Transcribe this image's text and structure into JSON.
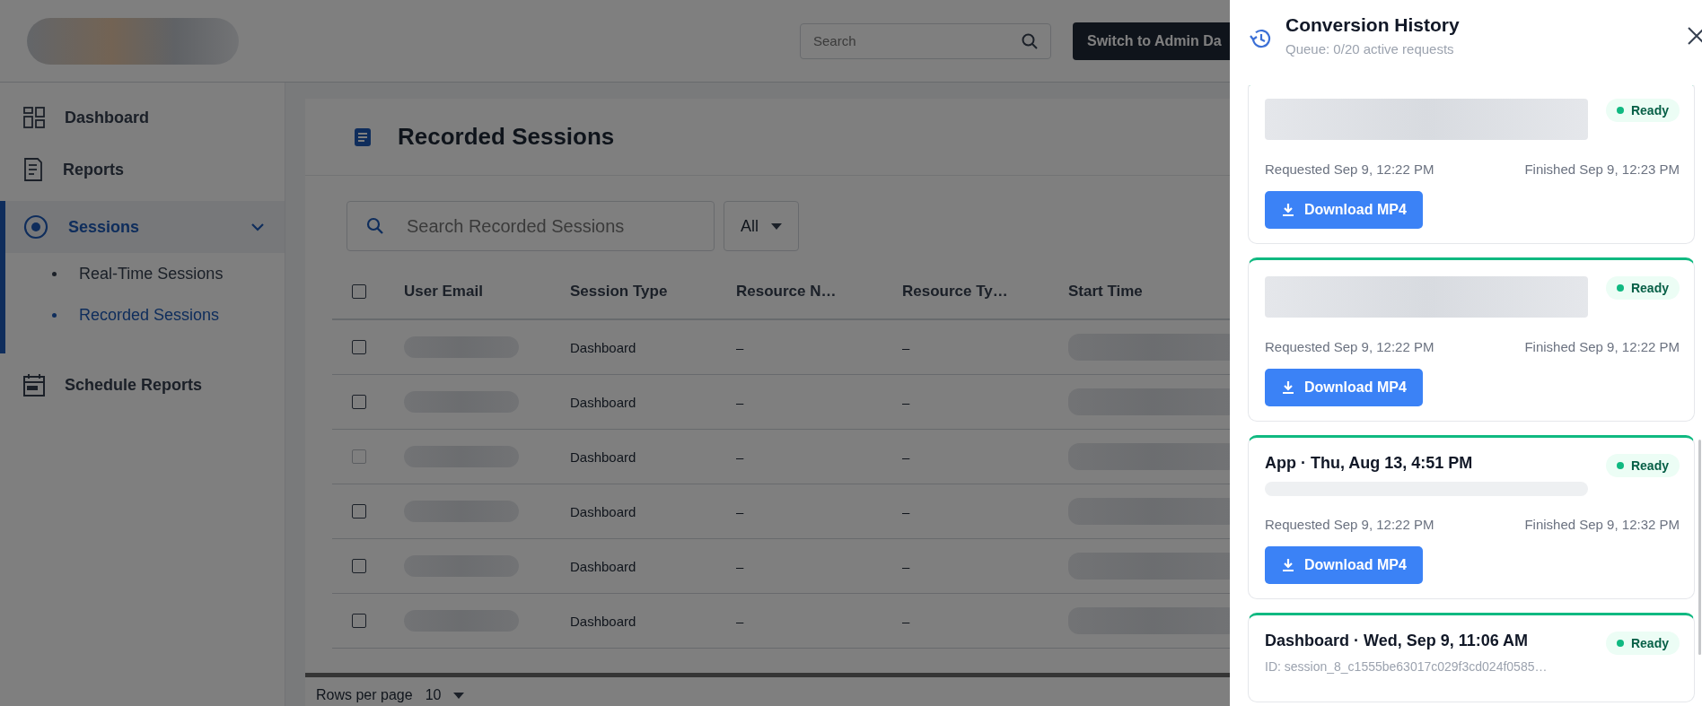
{
  "header": {
    "search": {
      "placeholder": "Search"
    },
    "admin_button": "Switch to Admin Da"
  },
  "sidebar": {
    "items": [
      {
        "label": "Dashboard",
        "kind": "grid",
        "selected": false
      },
      {
        "label": "Reports",
        "kind": "report",
        "selected": false
      },
      {
        "label": "Sessions",
        "kind": "target",
        "selected": true,
        "expanded": true,
        "children": [
          {
            "label": "Real-Time Sessions",
            "selected": false
          },
          {
            "label": "Recorded Sessions",
            "selected": true
          }
        ]
      },
      {
        "label": "Schedule Reports",
        "kind": "calendar",
        "selected": false
      }
    ]
  },
  "page": {
    "title": "Recorded Sessions",
    "search": {
      "placeholder": "Search Recorded Sessions"
    },
    "filter": "All",
    "table": {
      "all_checked": false,
      "columns": [
        "User Email",
        "Session Type",
        "Resource N…",
        "Resource Ty…",
        "Start Time"
      ],
      "rows": [
        {
          "checked": false,
          "disabled": false,
          "session_type": "Dashboard",
          "resource_name": "–",
          "resource_type": "–"
        },
        {
          "checked": false,
          "disabled": false,
          "session_type": "Dashboard",
          "resource_name": "–",
          "resource_type": "–"
        },
        {
          "checked": false,
          "disabled": true,
          "session_type": "Dashboard",
          "resource_name": "–",
          "resource_type": "–"
        },
        {
          "checked": false,
          "disabled": false,
          "session_type": "Dashboard",
          "resource_name": "–",
          "resource_type": "–"
        },
        {
          "checked": false,
          "disabled": false,
          "session_type": "Dashboard",
          "resource_name": "–",
          "resource_type": "–"
        },
        {
          "checked": false,
          "disabled": false,
          "session_type": "Dashboard",
          "resource_name": "–",
          "resource_type": "–"
        }
      ]
    },
    "pagination": {
      "label": "Rows per page",
      "value": "10"
    }
  },
  "drawer": {
    "title": "Conversion History",
    "subtitle": "Queue: 0/20 active requests",
    "items": [
      {
        "kind": "blurred",
        "status": "Ready",
        "requested": "Requested Sep 9, 12:22 PM",
        "finished": "Finished Sep 9, 12:23 PM",
        "button": "Download MP4"
      },
      {
        "kind": "blurred",
        "status": "Ready",
        "requested": "Requested Sep 9, 12:22 PM",
        "finished": "Finished Sep 9, 12:22 PM",
        "button": "Download MP4"
      },
      {
        "kind": "titled",
        "title": "App · Thu, Aug 13, 4:51 PM",
        "status": "Ready",
        "requested": "Requested Sep 9, 12:22 PM",
        "finished": "Finished Sep 9, 12:32 PM",
        "button": "Download MP4"
      },
      {
        "kind": "titled",
        "title": "Dashboard · Wed, Sep 9, 11:06 AM",
        "id": "ID: session_8_c1555be63017c029f3cd024f0585…",
        "status": "Ready"
      }
    ]
  }
}
